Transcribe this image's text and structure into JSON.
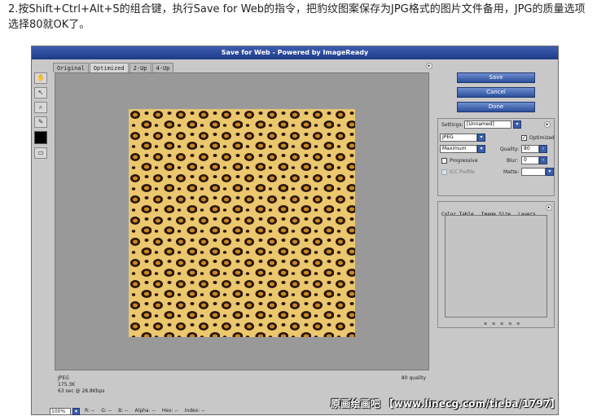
{
  "caption": "2.按Shift+Ctrl+Alt+S的组合键，执行Save for Web的指令，把豹纹图案保存为JPG格式的图片文件备用，JPG的质量选项选择80就OK了。",
  "window": {
    "title": "Save for Web - Powered by ImageReady"
  },
  "tabs": [
    "Original",
    "Optimized",
    "2-Up",
    "4-Up"
  ],
  "buttons": {
    "save": "Save",
    "cancel": "Cancel",
    "done": "Done"
  },
  "settings": {
    "label": "Settings:",
    "preset": "[Unnamed]",
    "format": "JPEG",
    "quality_preset": "Maximum",
    "optimized_label": "Optimized",
    "quality_label": "Quality:",
    "quality": "80",
    "progressive_label": "Progressive",
    "blur_label": "Blur:",
    "blur": "0",
    "icc_label": "ICC Profile",
    "matte_label": "Matte:"
  },
  "panel_tabs": [
    "Color Table",
    "Image Size",
    "Layers"
  ],
  "info": {
    "format": "JPEG",
    "size": "175.3K",
    "time": "63 sec @ 28.8Kbps",
    "quality": "80 quality"
  },
  "status": {
    "zoom": "100%",
    "r": "R: --",
    "g": "G: --",
    "b": "B: --",
    "alpha": "Alpha: --",
    "hex": "Hex: --",
    "index": "Index: --"
  },
  "watermark": "原画绘画吧 【www.linecg.com/tieba/1797】"
}
